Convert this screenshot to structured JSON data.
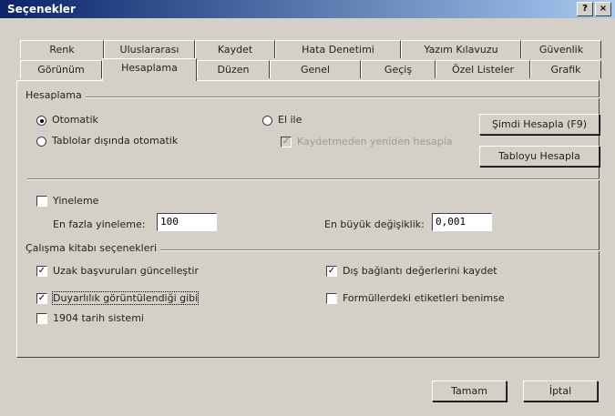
{
  "window": {
    "title": "Seçenekler",
    "help_button": "?",
    "close_button": "×"
  },
  "tabs_back": [
    "Renk",
    "Uluslararası",
    "Kaydet",
    "Hata Denetimi",
    "Yazım Kılavuzu",
    "Güvenlik"
  ],
  "tabs_front": [
    "Görünüm",
    "Hesaplama",
    "Düzen",
    "Genel",
    "Geçiş",
    "Özel Listeler",
    "Grafik"
  ],
  "active_tab": "Hesaplama",
  "calc": {
    "section_label": "Hesaplama",
    "opt_auto": "Otomatik",
    "opt_auto_except": "Tablolar dışında otomatik",
    "opt_manual": "El ile",
    "recalc_before_save": "Kaydetmeden yeniden hesapla",
    "calc_now_button": "Şimdi Hesapla (F9)",
    "calc_sheet_button": "Tabloyu Hesapla"
  },
  "iteration": {
    "label": "Yineleme",
    "max_iter_label": "En fazla yineleme:",
    "max_iter_value": "100",
    "max_change_label": "En büyük değişiklik:",
    "max_change_value": "0,001"
  },
  "workbook": {
    "section_label": "Çalışma kitabı seçenekleri",
    "update_remote": "Uzak başvuruları güncelleştir",
    "precision_as_displayed": "Duyarlılık görüntülendiği gibi",
    "date_1904": "1904 tarih sistemi",
    "save_external_links": "Dış bağlantı değerlerini kaydet",
    "accept_labels": "Formüllerdeki etiketleri benimse"
  },
  "footer": {
    "ok": "Tamam",
    "cancel": "İptal"
  }
}
